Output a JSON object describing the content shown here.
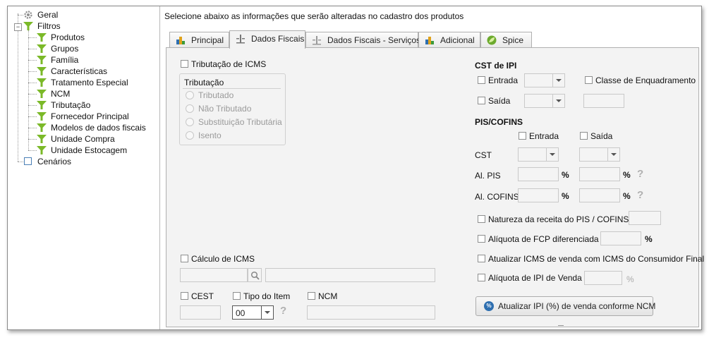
{
  "tree": {
    "items": [
      {
        "label": "Geral",
        "icon": "gear-icon"
      },
      {
        "label": "Filtros",
        "icon": "funnel-icon"
      },
      {
        "label": "Produtos",
        "icon": "funnel-icon"
      },
      {
        "label": "Grupos",
        "icon": "funnel-icon"
      },
      {
        "label": "Família",
        "icon": "funnel-icon"
      },
      {
        "label": "Características",
        "icon": "funnel-icon"
      },
      {
        "label": "Tratamento Especial",
        "icon": "funnel-icon"
      },
      {
        "label": "NCM",
        "icon": "funnel-icon"
      },
      {
        "label": "Tributação",
        "icon": "funnel-icon"
      },
      {
        "label": "Fornecedor Principal",
        "icon": "funnel-icon"
      },
      {
        "label": "Modelos de dados fiscais",
        "icon": "funnel-icon"
      },
      {
        "label": "Unidade Compra",
        "icon": "funnel-icon"
      },
      {
        "label": "Unidade Estocagem",
        "icon": "funnel-icon"
      },
      {
        "label": "Cenários",
        "icon": "square-icon"
      }
    ],
    "collapse_sign": "−"
  },
  "header": "Selecione abaixo as informações que serão alteradas no cadastro dos produtos",
  "tabs": [
    {
      "label": "Principal",
      "icon": "bar-chart-icon"
    },
    {
      "label": "Dados Fiscais",
      "icon": "scale-icon",
      "active": true
    },
    {
      "label": "Dados Fiscais - Serviços",
      "icon": "scale-icon"
    },
    {
      "label": "Adicional",
      "icon": "bar-chart-icon"
    },
    {
      "label": "Spice",
      "icon": "leaf-icon"
    }
  ],
  "icms": {
    "tributacao_label": "Tributação de ICMS",
    "group_label": "Tributação",
    "options": [
      "Tributado",
      "Não Tributado",
      "Substituição Tributária",
      "Isento"
    ]
  },
  "calculo": {
    "label": "Cálculo de ICMS"
  },
  "cest": {
    "label": "CEST"
  },
  "tipo_item": {
    "label": "Tipo do Item",
    "value": "00"
  },
  "ncm": {
    "label": "NCM"
  },
  "cst_ipi": {
    "title": "CST de IPI",
    "entrada": "Entrada",
    "saida": "Saída",
    "classe": "Classe de Enquadramento"
  },
  "pis": {
    "title": "PIS/COFINS",
    "entrada": "Entrada",
    "saida": "Saída",
    "cst": "CST",
    "al_pis": "Al. PIS",
    "al_cofins": "Al. COFINS",
    "pct": "%",
    "help": "?"
  },
  "natureza": {
    "label": "Natureza da receita do PIS / COFINS"
  },
  "fcp": {
    "label": "Alíquota de FCP diferenciada",
    "pct": "%"
  },
  "atualizar_icms": {
    "label": "Atualizar ICMS de venda com ICMS do Consumidor Final"
  },
  "ipi_venda": {
    "label": "Alíquota de IPI de Venda",
    "pct": "%"
  },
  "update_button": {
    "label": "Atualizar IPI (%) de venda conforme NCM",
    "icon_text": "%"
  },
  "colors": {
    "funnel": "#7bb928",
    "accent": "#2e6fb0"
  }
}
